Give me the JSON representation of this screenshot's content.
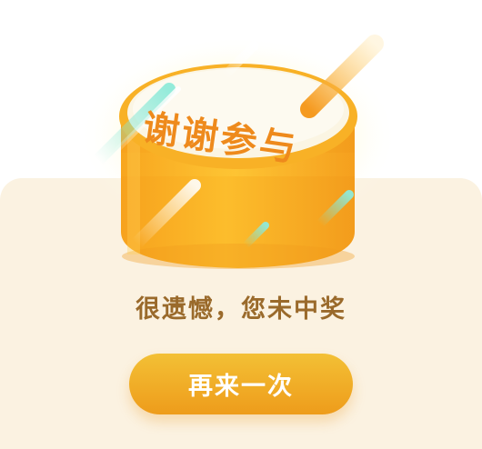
{
  "prize_box": {
    "lid_text": "谢谢参与"
  },
  "result": {
    "message": "很遗憾，您未中奖"
  },
  "actions": {
    "retry_label": "再来一次"
  },
  "colors": {
    "accent": "#f29d1e",
    "card_bg": "#fbf2e1",
    "message": "#9a6a2b",
    "lid_text": "#ee8a1c"
  }
}
